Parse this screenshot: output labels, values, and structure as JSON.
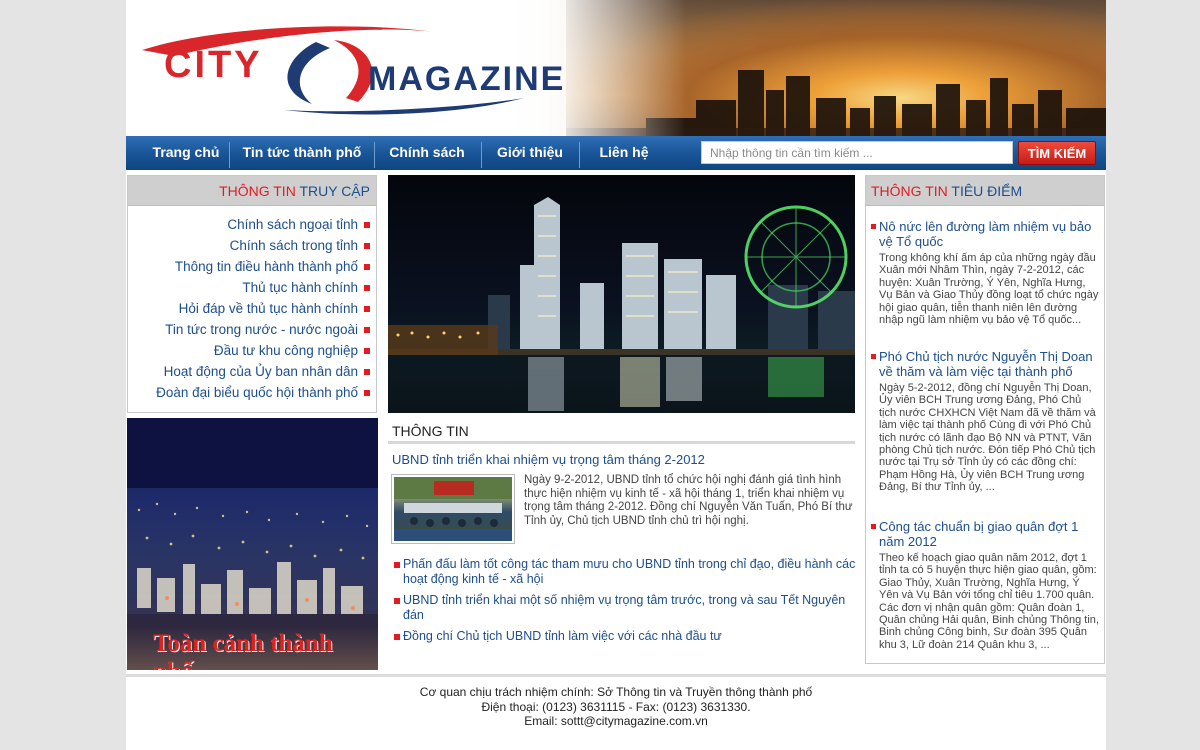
{
  "header": {
    "logo_city": "CITY",
    "logo_magazine": "MAGAZINE"
  },
  "nav": {
    "items": [
      "Trang chủ",
      "Tin tức thành phố",
      "Chính sách",
      "Giới thiệu",
      "Liên hệ"
    ],
    "search_placeholder": "Nhập thông tin cần tìm kiếm ...",
    "search_button": "TÌM KIẾM"
  },
  "left": {
    "heading_red": "THÔNG TIN",
    "heading_blue": "TRUY CẬP",
    "links": [
      "Chính sách ngoại tỉnh",
      "Chính sách trong tỉnh",
      "Thông tin điều hành thành phố",
      "Thủ tục hành chính",
      "Hỏi đáp về thủ tục hành chính",
      "Tin tức trong nước - nước ngoài",
      "Đầu tư khu công nghiệp",
      "Hoạt động của Ủy ban nhân dân",
      "Đoàn đại biểu quốc hội thành phố"
    ],
    "photo_caption": "Toàn cảnh thành phố"
  },
  "main": {
    "section_title": "THÔNG TIN",
    "lead_title": "UBND tỉnh triển khai nhiệm vụ trọng tâm tháng 2-2012",
    "lead_body": "Ngày 9-2-2012, UBND tỉnh tổ chức hội nghị đánh giá tình hình thực hiện nhiệm vụ kinh tế - xã hội tháng 1, triển khai nhiệm vụ trọng tâm tháng 2-2012. Đồng chí Nguyễn Văn Tuấn, Phó Bí thư Tỉnh ủy, Chủ tịch UBND tỉnh chủ trì hội nghị.",
    "more": [
      "Phấn đấu làm tốt công tác tham mưu cho UBND tỉnh trong chỉ đạo, điều hành các hoạt động kinh tế - xã hội",
      "UBND tỉnh triển khai một số nhiệm vụ trọng tâm trước, trong và sau Tết Nguyên đán",
      "Đồng chí Chủ tịch UBND tỉnh làm việc với các nhà đầu tư"
    ]
  },
  "right": {
    "heading_red": "THÔNG TIN",
    "heading_blue": "TIÊU ĐIỂM",
    "items": [
      {
        "title": "Nô nức lên đường làm nhiệm vụ bảo vệ Tổ quốc",
        "desc": "Trong không khí ấm áp của những ngày đầu Xuân mới Nhâm Thìn, ngày 7-2-2012, các huyện: Xuân Trường, Ý Yên, Nghĩa Hưng, Vụ Bản và Giao Thủy đồng loạt tổ chức ngày hội giao quân, tiễn thanh niên lên đường nhập ngũ làm nhiệm vụ bảo vệ Tổ quốc..."
      },
      {
        "title": "Phó Chủ tịch nước Nguyễn Thị Doan về thăm và làm việc tại thành phố",
        "desc": "Ngày 5-2-2012, đồng chí Nguyễn Thị Doan, Ủy viên BCH Trung ương Đảng, Phó Chủ tịch nước CHXHCN Việt Nam đã về thăm và làm việc tại thành phố Cùng đi với Phó Chủ tịch nước có lãnh đạo Bộ NN và PTNT, Văn phòng Chủ tịch nước. Đón tiếp Phó Chủ tịch nước tại Trụ sở Tỉnh ủy có các đồng chí: Phạm Hồng Hà, Ủy viên BCH Trung ương Đảng, Bí thư Tỉnh ủy, ..."
      },
      {
        "title": "Công tác chuẩn bị giao quân đợt 1 năm 2012",
        "desc": "Theo kế hoạch giao quân năm 2012, đợt 1 tỉnh ta có 5 huyện thực hiện giao quân, gồm: Giao Thủy, Xuân Trường, Nghĩa Hưng, Ý Yên và Vụ Bản với tổng chỉ tiêu 1.700 quân. Các đơn vị nhận quân gồm: Quân đoàn 1, Quân chủng Hải quân, Binh chủng Thông tin, Binh chủng Công binh, Sư đoàn 395 Quân khu 3, Lữ đoàn 214 Quân khu 3, ..."
      }
    ]
  },
  "footer": {
    "line1": "Cơ quan chịu trách nhiệm chính: Sở Thông tin và Truyền thông thành phố",
    "line2": "Điện thoại: (0123) 3631115 - Fax: (0123) 3631330.",
    "line3": "Email: sottt@citymagazine.com.vn"
  },
  "colors": {
    "nav_blue": "#1a5599",
    "accent_red": "#e21b23",
    "link_blue": "#1d4e8d"
  }
}
